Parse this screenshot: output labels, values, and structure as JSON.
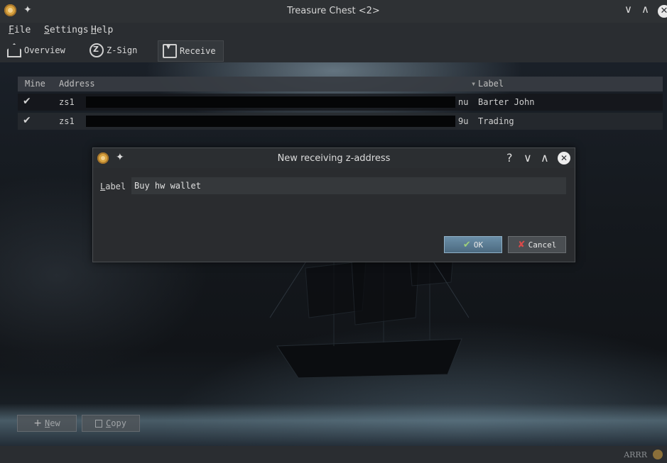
{
  "window": {
    "title": "Treasure Chest <2>",
    "controls": [
      "minimize-icon",
      "maximize-icon",
      "close-icon"
    ]
  },
  "menu": [
    {
      "accel": "F",
      "rest": "ile"
    },
    {
      "accel": "S",
      "rest": "ettings"
    },
    {
      "accel": "H",
      "rest": "elp"
    }
  ],
  "toolbar": {
    "overview": "Overview",
    "zsign": "Z-Sign",
    "receive": "Receive",
    "active": "receive"
  },
  "table": {
    "headers": {
      "mine": "Mine",
      "address": "Address",
      "label": "Label"
    },
    "sort_indicator": "▾",
    "rows": [
      {
        "mine": "✔",
        "address": "zs1",
        "address_tail": "nu",
        "label": "Barter John"
      },
      {
        "mine": "✔",
        "address": "zs1",
        "address_tail": "9u",
        "label": "Trading"
      }
    ]
  },
  "dialog": {
    "title": "New receiving z-address",
    "help": "?",
    "field_label_accel": "L",
    "field_label_rest": "abel",
    "field_value": "Buy hw wallet",
    "ok": "OK",
    "cancel": "Cancel"
  },
  "bottom": {
    "new_accel": "N",
    "new_rest": "ew",
    "copy_accel": "C",
    "copy_rest": "opy"
  },
  "status": {
    "text": "ARRR"
  }
}
